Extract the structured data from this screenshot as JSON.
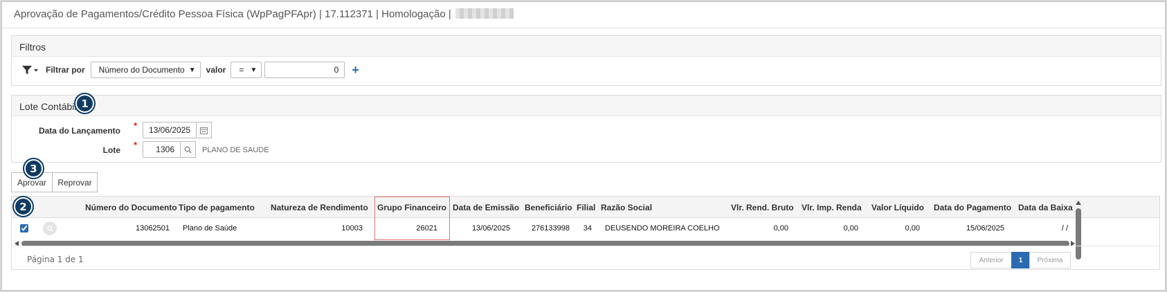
{
  "header": {
    "title": "Aprovação de Pagamentos/Crédito Pessoa Física (WpPagPFApr) | 17.112371 | Homologação |"
  },
  "filters": {
    "panel_title": "Filtros",
    "filter_by_label": "Filtrar por",
    "field_selected": "Número do Documento",
    "value_label": "valor",
    "operator_selected": "=",
    "value": "0",
    "add_symbol": "+"
  },
  "lote": {
    "panel_title": "Lote Contábil",
    "badge": "1",
    "date_label": "Data do Lançamento",
    "date_value": "13/06/2025",
    "lote_label": "Lote",
    "lote_value": "1306",
    "lote_description": "PLANO DE SAUDE",
    "required_mark": "*"
  },
  "actions": {
    "badge": "3",
    "approve_label": "Aprovar",
    "reject_label": "Reprovar"
  },
  "grid": {
    "badge": "2",
    "columns": [
      "Número do Documento",
      "Tipo de pagamento",
      "Natureza de Rendimento",
      "Grupo Financeiro",
      "Data de Emissão",
      "Beneficiário",
      "Filial",
      "Razão Social",
      "Vlr. Rend. Bruto",
      "Vlr. Imp. Renda",
      "Valor Líquido",
      "Data do Pagamento",
      "Data da Baixa"
    ],
    "rows": [
      {
        "selected": true,
        "cells": [
          "13062501",
          "Plano de Saúde",
          "10003",
          "26021",
          "13/06/2025",
          "276133998",
          "34",
          "DEUSENDO MOREIRA COELHO",
          "0,00",
          "0,00",
          "0,00",
          "15/06/2025",
          "/ /"
        ]
      }
    ],
    "highlight_color": "#e57373"
  },
  "pagination": {
    "page_info": "Página 1 de 1",
    "previous_label": "Anterior",
    "current_page": "1",
    "next_label": "Próxima"
  },
  "colors": {
    "badge": "#0e3a63",
    "accent": "#2a6bb0",
    "required": "#e0231a"
  }
}
